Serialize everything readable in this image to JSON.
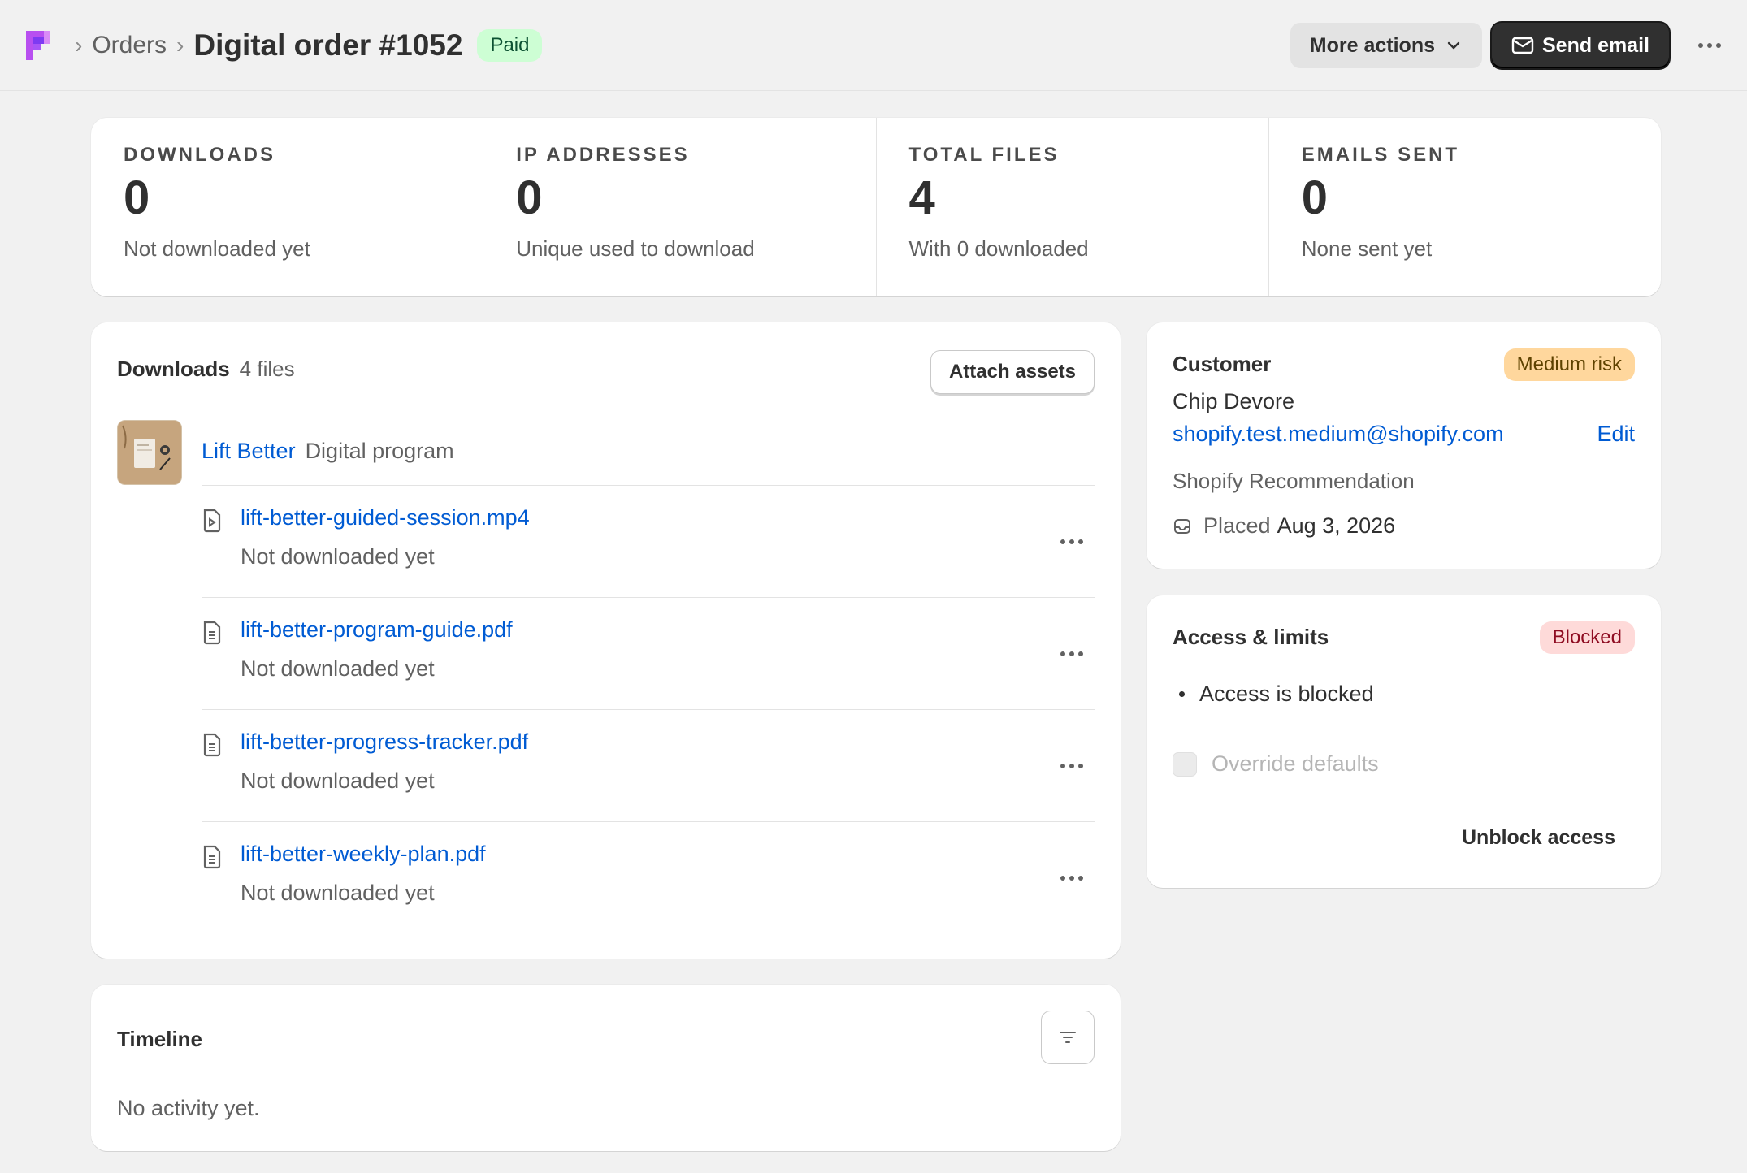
{
  "header": {
    "breadcrumb": "Orders",
    "title": "Digital order #1052",
    "status_badge": "Paid",
    "more_actions_label": "More actions",
    "send_email_label": "Send email"
  },
  "stats": [
    {
      "label": "DOWNLOADS",
      "value": "0",
      "sub": "Not downloaded yet"
    },
    {
      "label": "IP ADDRESSES",
      "value": "0",
      "sub": "Unique used to download"
    },
    {
      "label": "TOTAL FILES",
      "value": "4",
      "sub": "With 0 downloaded"
    },
    {
      "label": "EMAILS SENT",
      "value": "0",
      "sub": "None sent yet"
    }
  ],
  "downloads": {
    "title": "Downloads",
    "count": "4 files",
    "attach_label": "Attach assets",
    "product": {
      "name": "Lift Better",
      "type": "Digital program"
    },
    "files": [
      {
        "name": "lift-better-guided-session.mp4",
        "status": "Not downloaded yet",
        "icon": "video-file-icon"
      },
      {
        "name": "lift-better-program-guide.pdf",
        "status": "Not downloaded yet",
        "icon": "document-file-icon"
      },
      {
        "name": "lift-better-progress-tracker.pdf",
        "status": "Not downloaded yet",
        "icon": "document-file-icon"
      },
      {
        "name": "lift-better-weekly-plan.pdf",
        "status": "Not downloaded yet",
        "icon": "document-file-icon"
      }
    ]
  },
  "customer": {
    "title": "Customer",
    "risk_badge": "Medium risk",
    "name": "Chip Devore",
    "email": "shopify.test.medium@shopify.com",
    "edit_label": "Edit",
    "recommendation": "Shopify Recommendation",
    "placed_label": "Placed",
    "placed_date": "Aug 3, 2026"
  },
  "access": {
    "title": "Access & limits",
    "badge": "Blocked",
    "item": "Access is blocked",
    "override_label": "Override defaults",
    "unblock_label": "Unblock access"
  },
  "timeline": {
    "title": "Timeline",
    "empty": "No activity yet."
  },
  "colors": {
    "link": "#005bd3",
    "paid_bg": "#cdfed4",
    "medium_risk_bg": "#ffd79d",
    "blocked_bg": "#fedad9",
    "primary_button": "#303030"
  }
}
